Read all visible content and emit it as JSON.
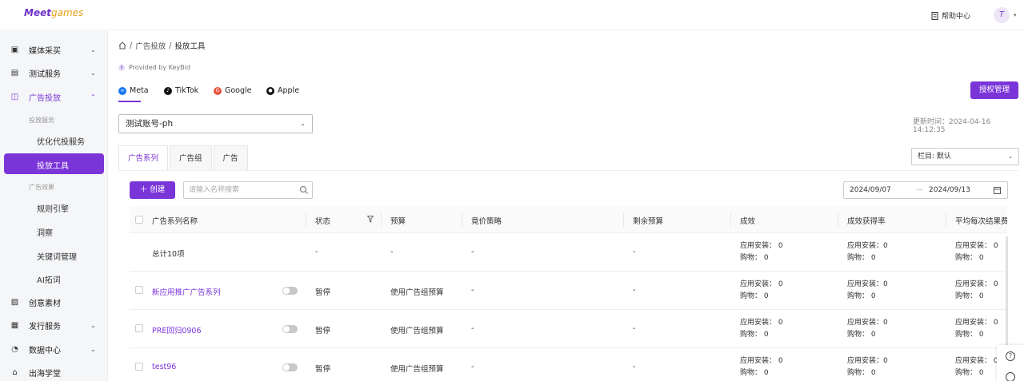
{
  "app": {
    "logo_main": "Meet",
    "logo_sub": "games",
    "help_label": "帮助中心",
    "avatar_letter": "T"
  },
  "sidebar": {
    "media_buy": "媒体采买",
    "test_service": "测试服务",
    "ad_delivery": "广告投放",
    "group_delivery_service": "投放服务",
    "optimized_delivery": "优化代投服务",
    "delivery_tool": "投放工具",
    "group_ad_effect": "广告效果",
    "rule_engine": "规则引擎",
    "insight": "洞察",
    "keyword_mgmt": "关键词管理",
    "ai_expand": "AI拓词",
    "creative": "创意素材",
    "publish_service": "发行服务",
    "data_center": "数据中心",
    "overseas_school": "出海学堂"
  },
  "breadcrumb": {
    "parent": "广告投放",
    "current": "投放工具"
  },
  "provided_by": "Provided by KeyBid",
  "platforms": [
    "Meta",
    "TikTok",
    "Google",
    "Apple"
  ],
  "auth_button": "授权管理",
  "account": {
    "selected": "测试账号-ph"
  },
  "updated_time": "更新时间：2024-04-16 14:12:35",
  "tabs": [
    "广告系列",
    "广告组",
    "广告"
  ],
  "column_select": "栏目: 默认",
  "create_button": "创建",
  "search": {
    "placeholder": "请输入名称搜索"
  },
  "date_range": {
    "start": "2024/09/07",
    "sep": "—",
    "end": "2024/09/13"
  },
  "table": {
    "headers": {
      "name": "广告系列名称",
      "status": "状态",
      "budget": "预算",
      "bid_strategy": "竟价策略",
      "remaining_budget": "剩余预算",
      "results": "成效",
      "result_rate": "成效获得率",
      "avg_cost": "平均每次结果费"
    },
    "summary": {
      "name": "总计10项",
      "status": "-",
      "budget": "-",
      "bid": "-",
      "remaining": "-",
      "results_install": "应用安装： 0",
      "results_purchase": "购物： 0",
      "rate_install": "应用安装：0",
      "rate_purchase": "购物： 0",
      "avg_install": "应用安装： 0",
      "avg_purchase": "购物： 0"
    },
    "rows": [
      {
        "name": "新应用推广广告系列",
        "status": "暂停",
        "budget": "使用广告组预算",
        "bid": "-",
        "remaining": "-",
        "results_install": "应用安装： 0",
        "results_purchase": "购物： 0",
        "rate_install": "应用安装：0",
        "rate_purchase": "购物： 0",
        "avg_install": "应用安装： 0",
        "avg_purchase": "购物： 0"
      },
      {
        "name": "PRE回归0906",
        "status": "暂停",
        "budget": "使用广告组预算",
        "bid": "-",
        "remaining": "-",
        "results_install": "应用安装： 0",
        "results_purchase": "购物： 0",
        "rate_install": "应用安装：0",
        "rate_purchase": "购物： 0",
        "avg_install": "应用安装： 0",
        "avg_purchase": "购物： 0"
      },
      {
        "name": "test96",
        "status": "暂停",
        "budget": "使用广告组预算",
        "bid": "-",
        "remaining": "-",
        "results_install": "应用安装： 0",
        "results_purchase": "购物： 0",
        "rate_install": "应用安装：0",
        "rate_purchase": "购物： 0",
        "avg_install": "应用安装： 0",
        "avg_purchase": "购物： 0"
      }
    ]
  },
  "floating": {
    "help_glyph": "?"
  },
  "colors": {
    "accent": "#7a35d8"
  }
}
